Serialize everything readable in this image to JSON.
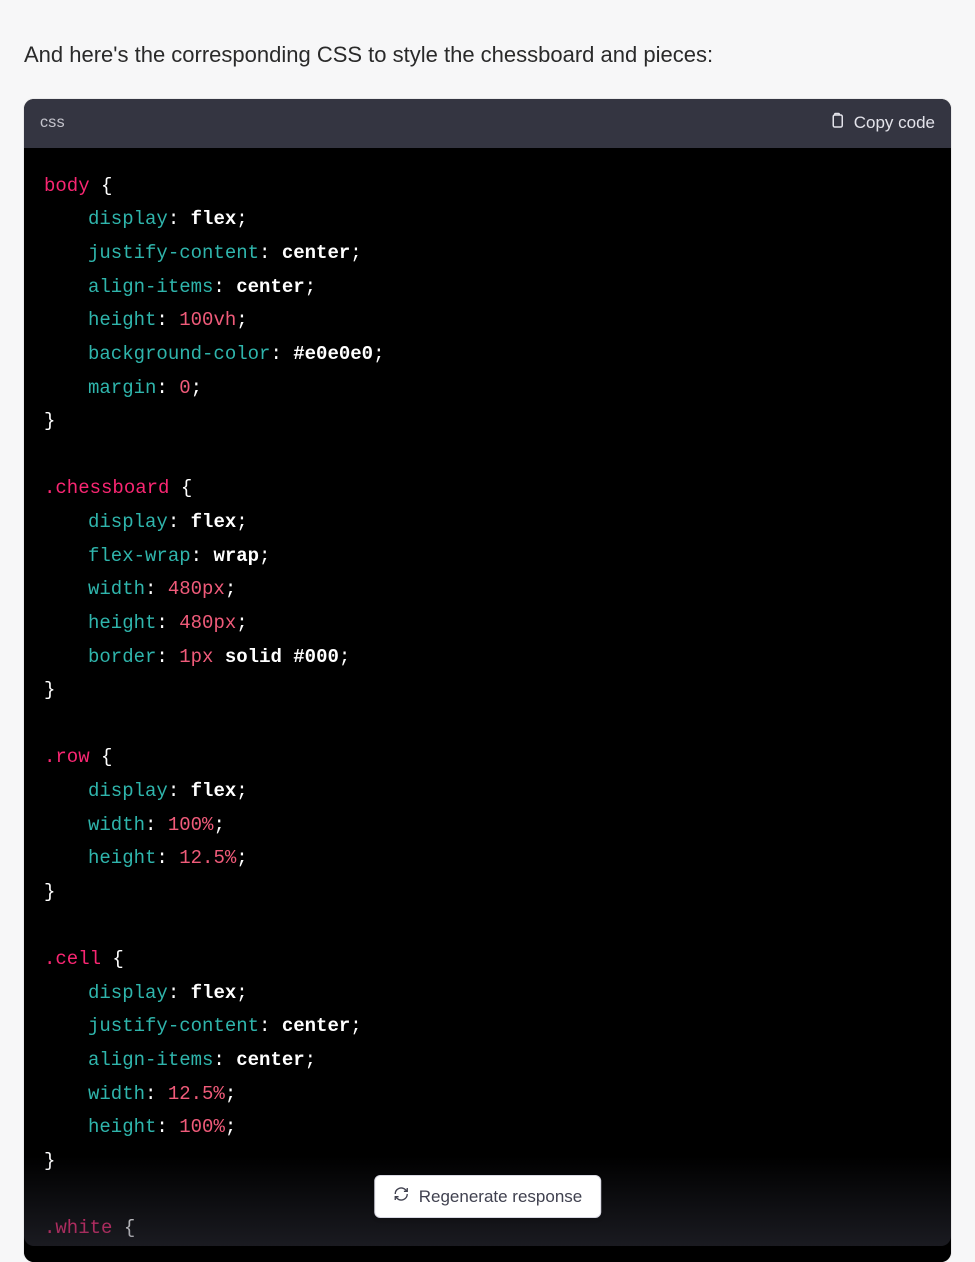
{
  "intro_text": "And here's the corresponding CSS to style the chessboard and pieces:",
  "code_block": {
    "language": "css",
    "copy_label": "Copy code"
  },
  "code": {
    "body": {
      "selector": "body",
      "props": {
        "display": {
          "name": "display",
          "value": "flex"
        },
        "justify": {
          "name": "justify-content",
          "value": "center"
        },
        "align": {
          "name": "align-items",
          "value": "center"
        },
        "height": {
          "name": "height",
          "value": "100vh"
        },
        "bg": {
          "name": "background-color",
          "value": "#e0e0e0"
        },
        "margin": {
          "name": "margin",
          "value": "0"
        }
      }
    },
    "chessboard": {
      "selector": ".chessboard",
      "props": {
        "display": {
          "name": "display",
          "value": "flex"
        },
        "wrap": {
          "name": "flex-wrap",
          "value": "wrap"
        },
        "width": {
          "name": "width",
          "value": "480px"
        },
        "height": {
          "name": "height",
          "value": "480px"
        },
        "border": {
          "name": "border",
          "num": "1px",
          "kw": "solid",
          "hex": "#000"
        }
      }
    },
    "row": {
      "selector": ".row",
      "props": {
        "display": {
          "name": "display",
          "value": "flex"
        },
        "width": {
          "name": "width",
          "value": "100%"
        },
        "height": {
          "name": "height",
          "value": "12.5%"
        }
      }
    },
    "cell": {
      "selector": ".cell",
      "props": {
        "display": {
          "name": "display",
          "value": "flex"
        },
        "justify": {
          "name": "justify-content",
          "value": "center"
        },
        "align": {
          "name": "align-items",
          "value": "center"
        },
        "width": {
          "name": "width",
          "value": "12.5%"
        },
        "height": {
          "name": "height",
          "value": "100%"
        }
      }
    },
    "white": {
      "selector": ".white"
    }
  },
  "regen_label": "Regenerate response"
}
